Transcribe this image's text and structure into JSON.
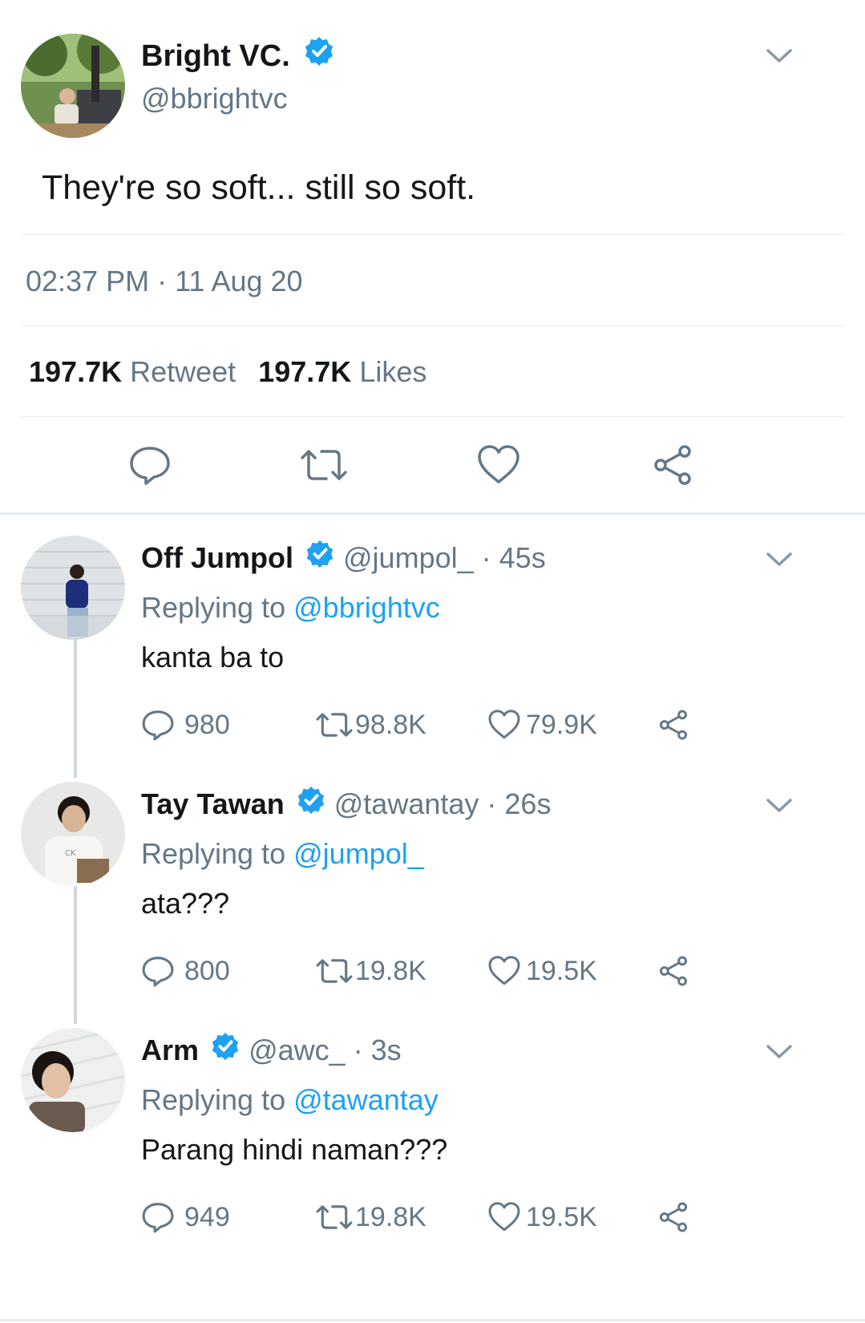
{
  "main_tweet": {
    "display_name": "Bright VC.",
    "handle": "@bbrightvc",
    "text": "They're so soft... still so soft.",
    "timestamp": "02:37 PM · 11 Aug 20",
    "retweets_count": "197.7K",
    "retweets_label": "Retweet",
    "likes_count": "197.7K",
    "likes_label": "Likes"
  },
  "replies": [
    {
      "display_name": "Off Jumpol",
      "handle": "@jumpol_",
      "time": "· 45s",
      "replying_prefix": "Replying to",
      "replying_to": "@bbrightvc",
      "text": "kanta ba to",
      "replies": "980",
      "retweets": "98.8K",
      "likes": "79.9K"
    },
    {
      "display_name": "Tay Tawan",
      "handle": "@tawantay",
      "time": "· 26s",
      "replying_prefix": "Replying to",
      "replying_to": "@jumpol_",
      "text": "ata???",
      "replies": "800",
      "retweets": "19.8K",
      "likes": "19.5K"
    },
    {
      "display_name": "Arm",
      "handle": "@awc_",
      "time": "· 3s",
      "replying_prefix": "Replying to",
      "replying_to": "@tawantay",
      "text": "Parang hindi naman???",
      "replies": "949",
      "retweets": "19.8K",
      "likes": "19.5K"
    }
  ],
  "icons": {
    "reply": "reply-icon",
    "retweet": "retweet-icon",
    "like": "heart-icon",
    "share": "share-icon",
    "verified": "verified-badge-icon",
    "more": "chevron-down-icon"
  },
  "colors": {
    "accent": "#1da1f2",
    "secondary_text": "#657786",
    "primary_text": "#14171a",
    "divider": "#e6ecf0"
  }
}
